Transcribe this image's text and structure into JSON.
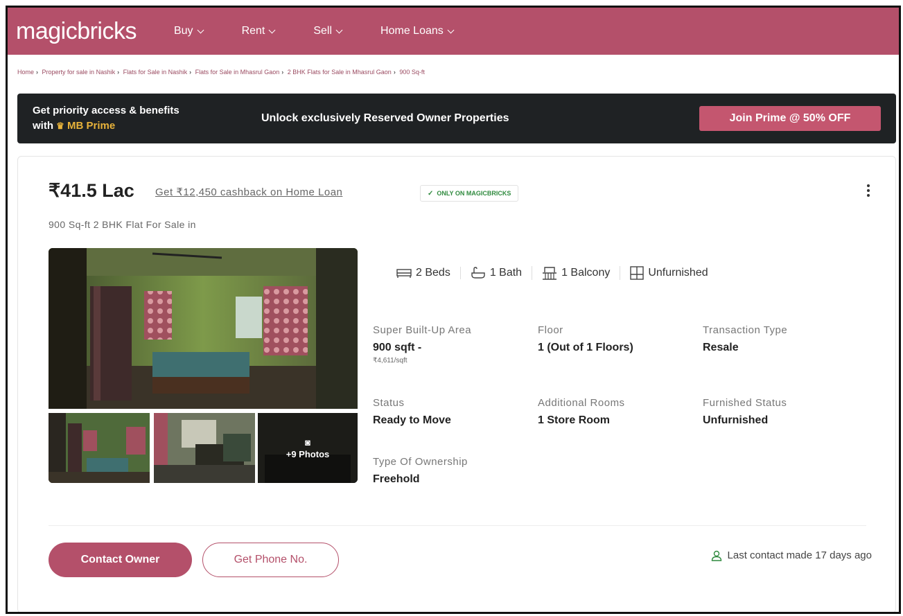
{
  "header": {
    "logo": "magicbricks",
    "nav": [
      {
        "label": "Buy"
      },
      {
        "label": "Rent"
      },
      {
        "label": "Sell"
      },
      {
        "label": "Home Loans"
      }
    ]
  },
  "breadcrumb": [
    "Home",
    "Property for sale in Nashik",
    "Flats for Sale in Nashik",
    "Flats for Sale in Mhasrul Gaon",
    "2 BHK Flats for Sale in Mhasrul Gaon",
    "900 Sq-ft"
  ],
  "prime_banner": {
    "line1": "Get priority access & benefits",
    "line2_prefix": "with",
    "brand": "MB Prime",
    "message": "Unlock exclusively Reserved Owner Properties",
    "cta": "Join Prime @ 50% OFF"
  },
  "listing": {
    "price": "₹41.5 Lac",
    "cashback": "Get ₹12,450 cashback on Home Loan",
    "badge": "ONLY ON MAGICBRICKS",
    "subtitle": "900 Sq-ft 2 BHK Flat For Sale in",
    "more_photos": "+9 Photos",
    "features": [
      {
        "icon": "bed-icon",
        "label": "2 Beds"
      },
      {
        "icon": "bath-icon",
        "label": "1 Bath"
      },
      {
        "icon": "balcony-icon",
        "label": "1 Balcony"
      },
      {
        "icon": "furnishing-icon",
        "label": "Unfurnished"
      }
    ],
    "specs": {
      "area": {
        "label": "Super Built-Up Area",
        "value": "900 sqft -",
        "sub": "₹4,611/sqft"
      },
      "floor": {
        "label": "Floor",
        "value": "1 (Out of 1 Floors)"
      },
      "transaction": {
        "label": "Transaction Type",
        "value": "Resale"
      },
      "status": {
        "label": "Status",
        "value": "Ready to Move"
      },
      "rooms": {
        "label": "Additional Rooms",
        "value": "1 Store Room"
      },
      "furnished": {
        "label": "Furnished Status",
        "value": "Unfurnished"
      },
      "ownership": {
        "label": "Type Of Ownership",
        "value": "Freehold"
      }
    },
    "contact_owner": "Contact Owner",
    "get_phone": "Get Phone No.",
    "last_contact": "Last contact made 17 days ago"
  },
  "colors": {
    "brand": "#b4506a",
    "banner_bg": "#1f2224",
    "accent_gold": "#e8b33a",
    "badge_green": "#2f8a3e"
  }
}
